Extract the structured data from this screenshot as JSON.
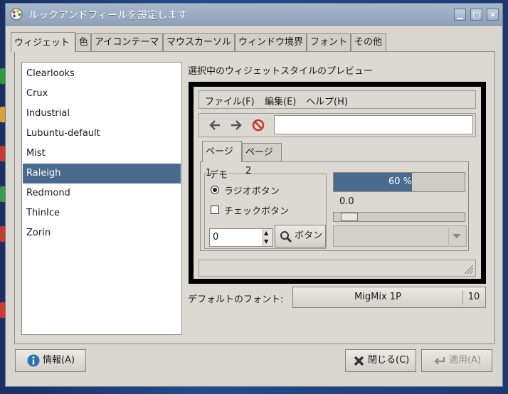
{
  "window": {
    "title": "ルックアンドフィールを設定します"
  },
  "tabs": [
    {
      "label": "ウィジェット",
      "active": true
    },
    {
      "label": "色"
    },
    {
      "label": "アイコンテーマ"
    },
    {
      "label": "マウスカーソル"
    },
    {
      "label": "ウィンドウ境界"
    },
    {
      "label": "フォント"
    },
    {
      "label": "その他"
    }
  ],
  "themes": [
    "Clearlooks",
    "Crux",
    "Industrial",
    "Lubuntu-default",
    "Mist",
    "Raleigh",
    "Redmond",
    "ThinIce",
    "Zorin"
  ],
  "selected_theme": "Raleigh",
  "preview": {
    "heading": "選択中のウィジェットスタイルのプレビュー",
    "menus": [
      "ファイル(F)",
      "編集(E)",
      "ヘルプ(H)"
    ],
    "tabs": [
      "ページ1",
      "ページ2"
    ],
    "frame_label": "デモ",
    "radio_label": "ラジオボタン",
    "check_label": "チェックボタン",
    "spin_value": "0",
    "search_button": "ボタン",
    "progress_text": "60 %",
    "progress_fraction": 0.6,
    "scale_value": "0.0"
  },
  "font": {
    "label": "デフォルトのフォント:",
    "name": "MigMix 1P",
    "size": "10"
  },
  "buttons": {
    "about": "情報(A)",
    "close": "閉じる(C)",
    "apply": "適用(A)"
  },
  "colors": {
    "selection": "#4a6a8e",
    "titlebar": "#97aac1",
    "stop": "#c8332c",
    "info": "#2c6fb5"
  }
}
